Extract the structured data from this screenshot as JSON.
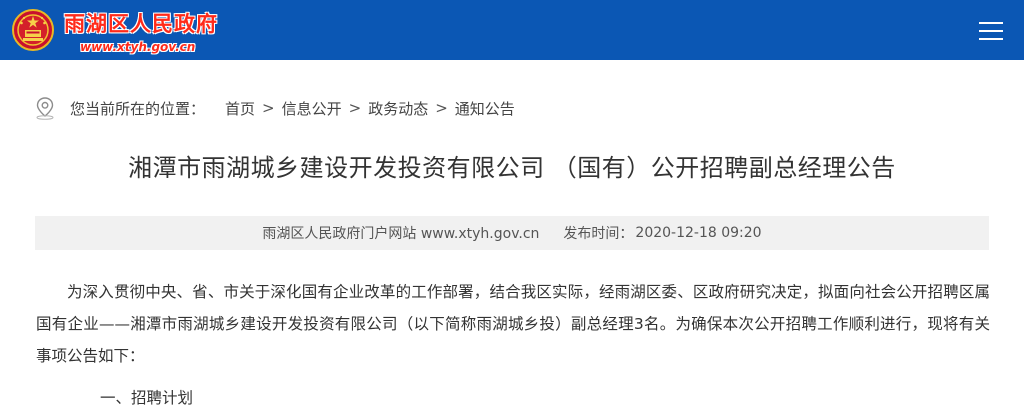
{
  "header": {
    "site_name": "雨湖区人民政府",
    "site_url": "www.xtyh.gov.cn",
    "emblem_icon": "national-emblem-icon",
    "menu_icon": "hamburger-menu-icon",
    "bg_color": "#0b57b4",
    "name_color": "#ff2a1a"
  },
  "breadcrumb": {
    "icon": "location-pin-icon",
    "prefix": "您当前所在的位置：",
    "items": [
      "首页",
      "信息公开",
      "政务动态",
      "通知公告"
    ],
    "separator": ">"
  },
  "article": {
    "title": "湘潭市雨湖城乡建设开发投资有限公司 （国有）公开招聘副总经理公告",
    "source": "雨湖区人民政府门户网站 www.xtyh.gov.cn",
    "time_label": "发布时间：",
    "time_value": "2020-12-18 09:20",
    "paragraph_1": "为深入贯彻中央、省、市关于深化国有企业改革的工作部署，结合我区实际，经雨湖区委、区政府研究决定，拟面向社会公开招聘区属国有企业——湘潭市雨湖城乡建设开发投资有限公司（以下简称雨湖城乡投）副总经理3名。为确保本次公开招聘工作顺利进行，现将有关事项公告如下：",
    "next_heading_partial": "一、招聘计划"
  }
}
